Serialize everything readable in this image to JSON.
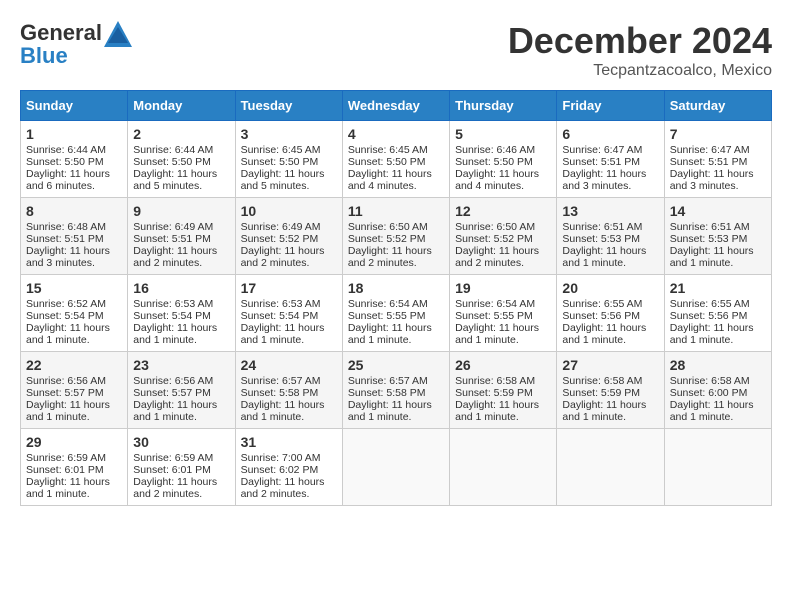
{
  "header": {
    "logo_line1": "General",
    "logo_line2": "Blue",
    "month": "December 2024",
    "location": "Tecpantzacoalco, Mexico"
  },
  "weekdays": [
    "Sunday",
    "Monday",
    "Tuesday",
    "Wednesday",
    "Thursday",
    "Friday",
    "Saturday"
  ],
  "weeks": [
    [
      {
        "day": "1",
        "lines": [
          "Sunrise: 6:44 AM",
          "Sunset: 5:50 PM",
          "Daylight: 11 hours",
          "and 6 minutes."
        ]
      },
      {
        "day": "2",
        "lines": [
          "Sunrise: 6:44 AM",
          "Sunset: 5:50 PM",
          "Daylight: 11 hours",
          "and 5 minutes."
        ]
      },
      {
        "day": "3",
        "lines": [
          "Sunrise: 6:45 AM",
          "Sunset: 5:50 PM",
          "Daylight: 11 hours",
          "and 5 minutes."
        ]
      },
      {
        "day": "4",
        "lines": [
          "Sunrise: 6:45 AM",
          "Sunset: 5:50 PM",
          "Daylight: 11 hours",
          "and 4 minutes."
        ]
      },
      {
        "day": "5",
        "lines": [
          "Sunrise: 6:46 AM",
          "Sunset: 5:50 PM",
          "Daylight: 11 hours",
          "and 4 minutes."
        ]
      },
      {
        "day": "6",
        "lines": [
          "Sunrise: 6:47 AM",
          "Sunset: 5:51 PM",
          "Daylight: 11 hours",
          "and 3 minutes."
        ]
      },
      {
        "day": "7",
        "lines": [
          "Sunrise: 6:47 AM",
          "Sunset: 5:51 PM",
          "Daylight: 11 hours",
          "and 3 minutes."
        ]
      }
    ],
    [
      {
        "day": "8",
        "lines": [
          "Sunrise: 6:48 AM",
          "Sunset: 5:51 PM",
          "Daylight: 11 hours",
          "and 3 minutes."
        ]
      },
      {
        "day": "9",
        "lines": [
          "Sunrise: 6:49 AM",
          "Sunset: 5:51 PM",
          "Daylight: 11 hours",
          "and 2 minutes."
        ]
      },
      {
        "day": "10",
        "lines": [
          "Sunrise: 6:49 AM",
          "Sunset: 5:52 PM",
          "Daylight: 11 hours",
          "and 2 minutes."
        ]
      },
      {
        "day": "11",
        "lines": [
          "Sunrise: 6:50 AM",
          "Sunset: 5:52 PM",
          "Daylight: 11 hours",
          "and 2 minutes."
        ]
      },
      {
        "day": "12",
        "lines": [
          "Sunrise: 6:50 AM",
          "Sunset: 5:52 PM",
          "Daylight: 11 hours",
          "and 2 minutes."
        ]
      },
      {
        "day": "13",
        "lines": [
          "Sunrise: 6:51 AM",
          "Sunset: 5:53 PM",
          "Daylight: 11 hours",
          "and 1 minute."
        ]
      },
      {
        "day": "14",
        "lines": [
          "Sunrise: 6:51 AM",
          "Sunset: 5:53 PM",
          "Daylight: 11 hours",
          "and 1 minute."
        ]
      }
    ],
    [
      {
        "day": "15",
        "lines": [
          "Sunrise: 6:52 AM",
          "Sunset: 5:54 PM",
          "Daylight: 11 hours",
          "and 1 minute."
        ]
      },
      {
        "day": "16",
        "lines": [
          "Sunrise: 6:53 AM",
          "Sunset: 5:54 PM",
          "Daylight: 11 hours",
          "and 1 minute."
        ]
      },
      {
        "day": "17",
        "lines": [
          "Sunrise: 6:53 AM",
          "Sunset: 5:54 PM",
          "Daylight: 11 hours",
          "and 1 minute."
        ]
      },
      {
        "day": "18",
        "lines": [
          "Sunrise: 6:54 AM",
          "Sunset: 5:55 PM",
          "Daylight: 11 hours",
          "and 1 minute."
        ]
      },
      {
        "day": "19",
        "lines": [
          "Sunrise: 6:54 AM",
          "Sunset: 5:55 PM",
          "Daylight: 11 hours",
          "and 1 minute."
        ]
      },
      {
        "day": "20",
        "lines": [
          "Sunrise: 6:55 AM",
          "Sunset: 5:56 PM",
          "Daylight: 11 hours",
          "and 1 minute."
        ]
      },
      {
        "day": "21",
        "lines": [
          "Sunrise: 6:55 AM",
          "Sunset: 5:56 PM",
          "Daylight: 11 hours",
          "and 1 minute."
        ]
      }
    ],
    [
      {
        "day": "22",
        "lines": [
          "Sunrise: 6:56 AM",
          "Sunset: 5:57 PM",
          "Daylight: 11 hours",
          "and 1 minute."
        ]
      },
      {
        "day": "23",
        "lines": [
          "Sunrise: 6:56 AM",
          "Sunset: 5:57 PM",
          "Daylight: 11 hours",
          "and 1 minute."
        ]
      },
      {
        "day": "24",
        "lines": [
          "Sunrise: 6:57 AM",
          "Sunset: 5:58 PM",
          "Daylight: 11 hours",
          "and 1 minute."
        ]
      },
      {
        "day": "25",
        "lines": [
          "Sunrise: 6:57 AM",
          "Sunset: 5:58 PM",
          "Daylight: 11 hours",
          "and 1 minute."
        ]
      },
      {
        "day": "26",
        "lines": [
          "Sunrise: 6:58 AM",
          "Sunset: 5:59 PM",
          "Daylight: 11 hours",
          "and 1 minute."
        ]
      },
      {
        "day": "27",
        "lines": [
          "Sunrise: 6:58 AM",
          "Sunset: 5:59 PM",
          "Daylight: 11 hours",
          "and 1 minute."
        ]
      },
      {
        "day": "28",
        "lines": [
          "Sunrise: 6:58 AM",
          "Sunset: 6:00 PM",
          "Daylight: 11 hours",
          "and 1 minute."
        ]
      }
    ],
    [
      {
        "day": "29",
        "lines": [
          "Sunrise: 6:59 AM",
          "Sunset: 6:01 PM",
          "Daylight: 11 hours",
          "and 1 minute."
        ]
      },
      {
        "day": "30",
        "lines": [
          "Sunrise: 6:59 AM",
          "Sunset: 6:01 PM",
          "Daylight: 11 hours",
          "and 2 minutes."
        ]
      },
      {
        "day": "31",
        "lines": [
          "Sunrise: 7:00 AM",
          "Sunset: 6:02 PM",
          "Daylight: 11 hours",
          "and 2 minutes."
        ]
      },
      {
        "day": "",
        "lines": []
      },
      {
        "day": "",
        "lines": []
      },
      {
        "day": "",
        "lines": []
      },
      {
        "day": "",
        "lines": []
      }
    ]
  ]
}
